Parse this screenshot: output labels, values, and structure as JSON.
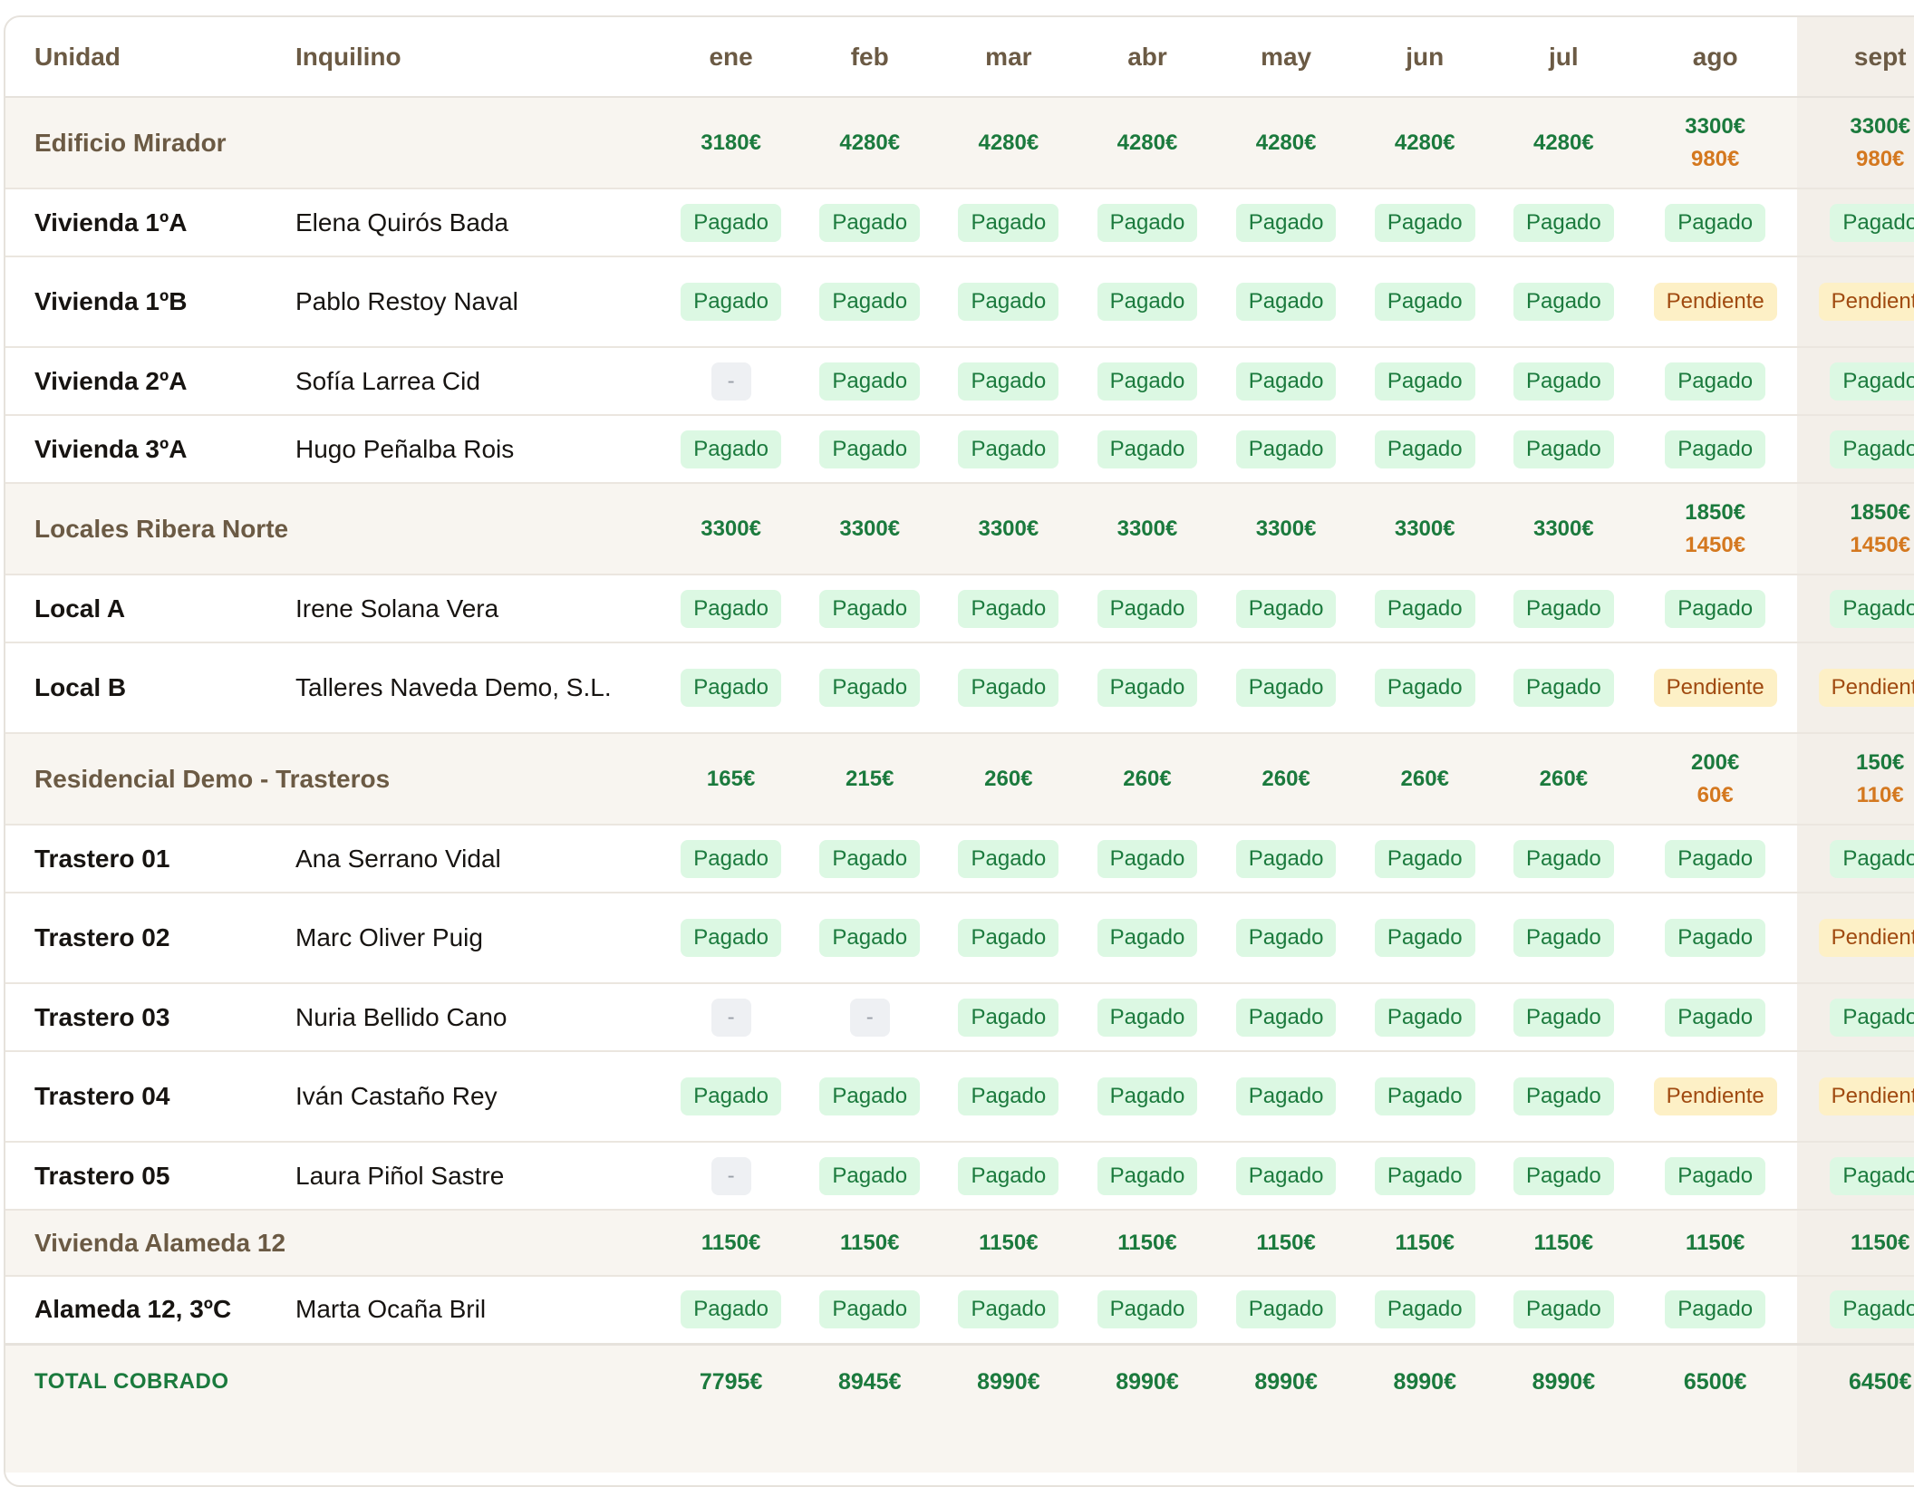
{
  "columns": {
    "unit": "Unidad",
    "tenant": "Inquilino",
    "months": [
      "ene",
      "feb",
      "mar",
      "abr",
      "may",
      "jun",
      "jul",
      "ago",
      "sept"
    ]
  },
  "groups": [
    {
      "name": "Edificio Mirador",
      "totals": [
        {
          "paid": "3180€"
        },
        {
          "paid": "4280€"
        },
        {
          "paid": "4280€"
        },
        {
          "paid": "4280€"
        },
        {
          "paid": "4280€"
        },
        {
          "paid": "4280€"
        },
        {
          "paid": "4280€"
        },
        {
          "paid": "3300€",
          "due": "980€"
        },
        {
          "paid": "3300€",
          "due": "980€"
        }
      ],
      "units": [
        {
          "name": "Vivienda 1ºA",
          "tenant": "Elena Quirós Bada",
          "status": [
            "paid",
            "paid",
            "paid",
            "paid",
            "paid",
            "paid",
            "paid",
            "paid",
            "paid"
          ]
        },
        {
          "name": "Vivienda 1ºB",
          "tenant": "Pablo Restoy Naval",
          "status": [
            "paid",
            "paid",
            "paid",
            "paid",
            "paid",
            "paid",
            "paid",
            "pending",
            "pending"
          ]
        },
        {
          "name": "Vivienda 2ºA",
          "tenant": "Sofía Larrea Cid",
          "status": [
            "none",
            "paid",
            "paid",
            "paid",
            "paid",
            "paid",
            "paid",
            "paid",
            "paid"
          ]
        },
        {
          "name": "Vivienda 3ºA",
          "tenant": "Hugo Peñalba Rois",
          "status": [
            "paid",
            "paid",
            "paid",
            "paid",
            "paid",
            "paid",
            "paid",
            "paid",
            "paid"
          ]
        }
      ]
    },
    {
      "name": "Locales Ribera Norte",
      "totals": [
        {
          "paid": "3300€"
        },
        {
          "paid": "3300€"
        },
        {
          "paid": "3300€"
        },
        {
          "paid": "3300€"
        },
        {
          "paid": "3300€"
        },
        {
          "paid": "3300€"
        },
        {
          "paid": "3300€"
        },
        {
          "paid": "1850€",
          "due": "1450€"
        },
        {
          "paid": "1850€",
          "due": "1450€"
        }
      ],
      "units": [
        {
          "name": "Local A",
          "tenant": "Irene Solana Vera",
          "status": [
            "paid",
            "paid",
            "paid",
            "paid",
            "paid",
            "paid",
            "paid",
            "paid",
            "paid"
          ]
        },
        {
          "name": "Local B",
          "tenant": "Talleres Naveda Demo, S.L.",
          "status": [
            "paid",
            "paid",
            "paid",
            "paid",
            "paid",
            "paid",
            "paid",
            "pending",
            "pending"
          ]
        }
      ]
    },
    {
      "name": "Residencial Demo - Trasteros",
      "totals": [
        {
          "paid": "165€"
        },
        {
          "paid": "215€"
        },
        {
          "paid": "260€"
        },
        {
          "paid": "260€"
        },
        {
          "paid": "260€"
        },
        {
          "paid": "260€"
        },
        {
          "paid": "260€"
        },
        {
          "paid": "200€",
          "due": "60€"
        },
        {
          "paid": "150€",
          "due": "110€"
        }
      ],
      "units": [
        {
          "name": "Trastero 01",
          "tenant": "Ana Serrano Vidal",
          "status": [
            "paid",
            "paid",
            "paid",
            "paid",
            "paid",
            "paid",
            "paid",
            "paid",
            "paid"
          ]
        },
        {
          "name": "Trastero 02",
          "tenant": "Marc Oliver Puig",
          "status": [
            "paid",
            "paid",
            "paid",
            "paid",
            "paid",
            "paid",
            "paid",
            "paid",
            "pending"
          ]
        },
        {
          "name": "Trastero 03",
          "tenant": "Nuria Bellido Cano",
          "status": [
            "none",
            "none",
            "paid",
            "paid",
            "paid",
            "paid",
            "paid",
            "paid",
            "paid"
          ]
        },
        {
          "name": "Trastero 04",
          "tenant": "Iván Castaño Rey",
          "status": [
            "paid",
            "paid",
            "paid",
            "paid",
            "paid",
            "paid",
            "paid",
            "pending",
            "pending"
          ]
        },
        {
          "name": "Trastero 05",
          "tenant": "Laura Piñol Sastre",
          "status": [
            "none",
            "paid",
            "paid",
            "paid",
            "paid",
            "paid",
            "paid",
            "paid",
            "paid"
          ]
        }
      ]
    },
    {
      "name": "Vivienda Alameda 12",
      "totals": [
        {
          "paid": "1150€"
        },
        {
          "paid": "1150€"
        },
        {
          "paid": "1150€"
        },
        {
          "paid": "1150€"
        },
        {
          "paid": "1150€"
        },
        {
          "paid": "1150€"
        },
        {
          "paid": "1150€"
        },
        {
          "paid": "1150€"
        },
        {
          "paid": "1150€"
        }
      ],
      "units": [
        {
          "name": "Alameda 12, 3ºC",
          "tenant": "Marta Ocaña Bril",
          "status": [
            "paid",
            "paid",
            "paid",
            "paid",
            "paid",
            "paid",
            "paid",
            "paid",
            "paid"
          ]
        }
      ]
    }
  ],
  "status_labels": {
    "paid": "Pagado",
    "pending": "Pendiente",
    "none": "-"
  },
  "total": {
    "label": "TOTAL COBRADO",
    "values": [
      "7795€",
      "8945€",
      "8990€",
      "8990€",
      "8990€",
      "8990€",
      "8990€",
      "6500€",
      "6450€"
    ]
  },
  "colors": {
    "paid_text": "#1b7a3d",
    "paid_bg": "#dcf8e3",
    "pending_text": "#a04a10",
    "pending_bg": "#fdf0c6",
    "due_amount": "#d4781f",
    "group_bg": "#f8f5f0",
    "current_month_bg": "#f3efe9"
  }
}
